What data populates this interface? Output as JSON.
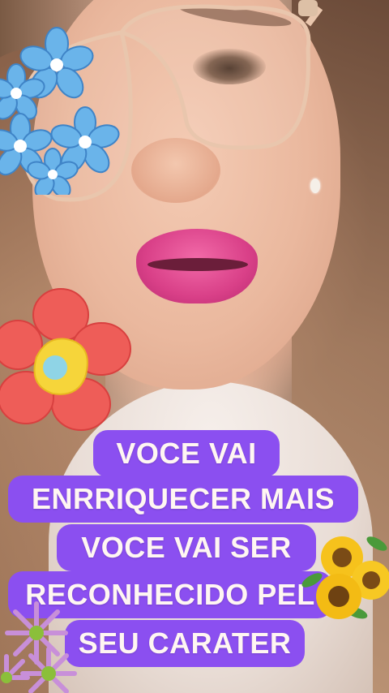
{
  "image": {
    "description_colors": {
      "caption_background": "#8b4ff0",
      "caption_text": "#fff6f2",
      "lipstick": "#e0468e"
    }
  },
  "caption": {
    "lines": [
      "VOCE VAI",
      "ENRRIQUECER MAIS",
      "VOCE VAI SER",
      "RECONHECIDO PEL",
      "SEU CARATER"
    ]
  },
  "stickers": [
    {
      "icon": "blue-flowers-cluster-icon"
    },
    {
      "icon": "red-flower-icon"
    },
    {
      "icon": "sunflowers-icon"
    },
    {
      "icon": "pink-daisies-icon"
    }
  ]
}
